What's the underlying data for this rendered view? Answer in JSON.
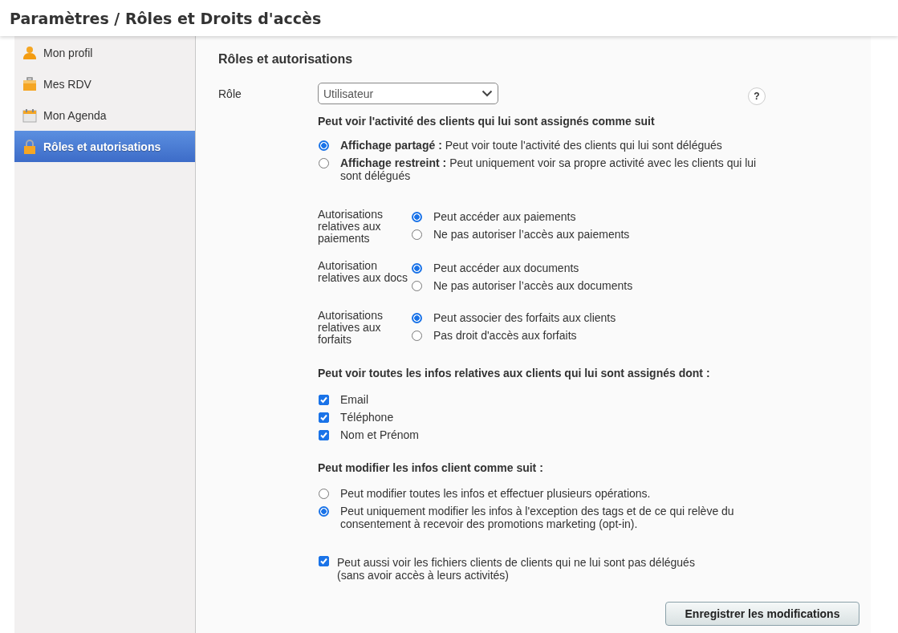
{
  "page_title": "Paramètres / Rôles et Droits d'accès",
  "sidebar": {
    "items": [
      {
        "label": "Mon profil",
        "selected": false
      },
      {
        "label": "Mes RDV",
        "selected": false
      },
      {
        "label": "Mon Agenda",
        "selected": false
      },
      {
        "label": "Rôles et autorisations",
        "selected": true
      }
    ]
  },
  "section_title": "Rôles et autorisations",
  "role": {
    "label": "Rôle",
    "value": "Utilisateur",
    "help": "?"
  },
  "activity": {
    "heading": "Peut voir l'activité des clients qui lui sont assignés comme suit",
    "options": [
      {
        "text": "**Affichage partagé :** Peut voir toute l'activité des clients qui lui sont délégués",
        "selected": true
      },
      {
        "text": "**Affichage restreint :** Peut uniquement voir sa propre activité avec les clients qui lui sont délégués",
        "selected": false
      }
    ]
  },
  "permissions": [
    {
      "label": "Autorisations relatives aux paiements",
      "options": [
        {
          "text": "Peut accéder aux paiements",
          "selected": true
        },
        {
          "text": "Ne pas autoriser l’accès aux paiements",
          "selected": false
        }
      ]
    },
    {
      "label": "Autorisation relatives aux docs",
      "options": [
        {
          "text": "Peut accéder aux documents",
          "selected": true
        },
        {
          "text": "Ne pas autoriser l’accès aux documents",
          "selected": false
        }
      ]
    },
    {
      "label": "Autorisations relatives aux forfaits",
      "options": [
        {
          "text": "Peut associer des forfaits aux clients",
          "selected": true
        },
        {
          "text": "Pas droit d'accès aux forfaits",
          "selected": false
        }
      ]
    }
  ],
  "info": {
    "heading": "Peut voir toutes les infos relatives aux clients qui lui sont assignés dont :",
    "items": [
      {
        "label": "Email",
        "checked": true
      },
      {
        "label": "Téléphone",
        "checked": true
      },
      {
        "label": "Nom et Prénom",
        "checked": true
      }
    ]
  },
  "edit": {
    "heading": "Peut modifier les infos client comme suit :",
    "options": [
      {
        "text": "Peut modifier toutes les infos et effectuer plusieurs opérations.",
        "selected": false
      },
      {
        "text": "Peut uniquement modifier les infos à l'exception des tags et de ce qui relève du consentement à recevoir des promotions marketing (opt-in).",
        "selected": true
      }
    ]
  },
  "extra": {
    "lines": [
      "Peut aussi voir les fichiers clients de clients qui ne lui sont pas délégués",
      "(sans avoir accès à leurs activités)"
    ],
    "checked": true
  },
  "save_button": "Enregistrer les modifications"
}
